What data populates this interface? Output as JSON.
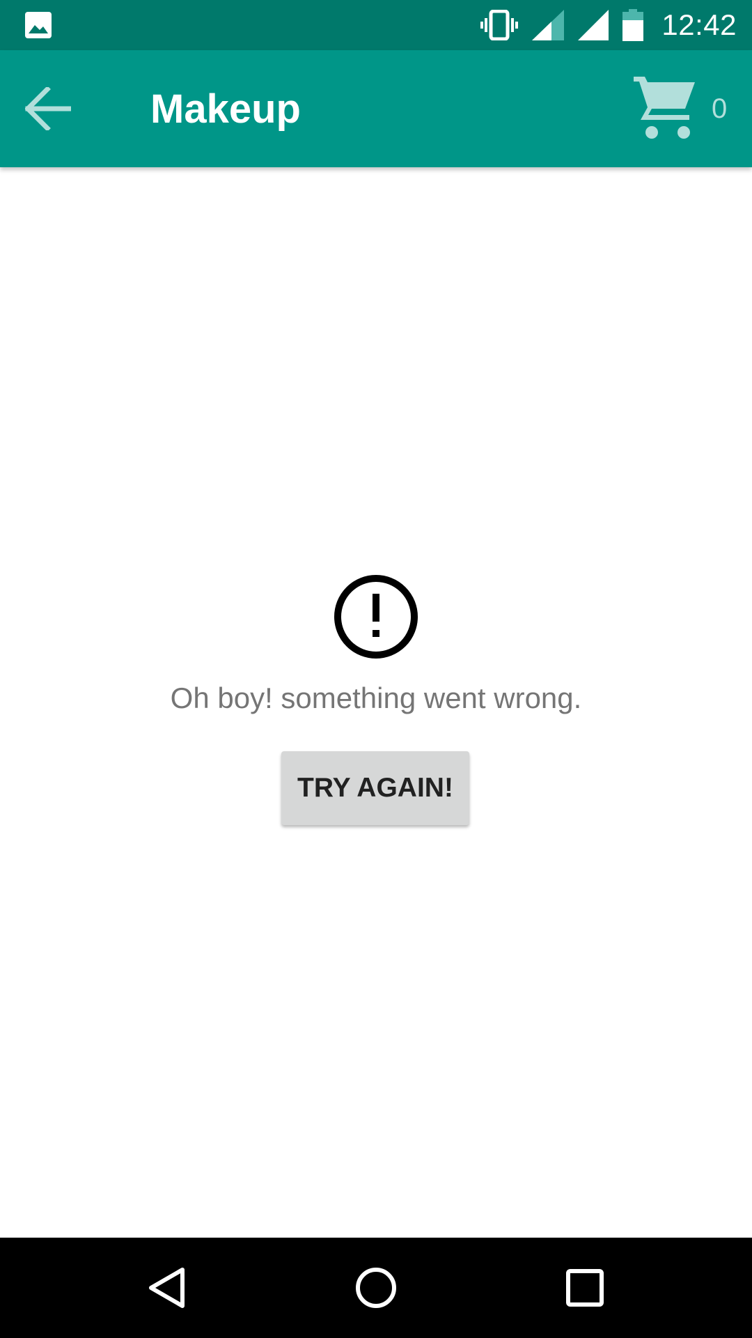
{
  "status_bar": {
    "time": "12:42",
    "icons": [
      "gallery-icon",
      "vibrate-icon",
      "signal-icon",
      "signal-full-icon",
      "battery-icon"
    ]
  },
  "app_bar": {
    "title": "Makeup",
    "back_icon": "arrow-back-icon",
    "cart_icon": "shopping-cart-icon",
    "cart_count": "0"
  },
  "error": {
    "icon": "error-circle-icon",
    "message": "Oh boy! something went wrong.",
    "retry_label": "TRY AGAIN!"
  },
  "nav_bar": {
    "buttons": [
      "back-triangle-icon",
      "home-circle-icon",
      "recents-square-icon"
    ]
  },
  "colors": {
    "status_bar": "#00796B",
    "app_bar": "#009688",
    "cart_icon": "#B2DFDB",
    "button_bg": "#D6D7D7",
    "message_text": "#757575"
  }
}
